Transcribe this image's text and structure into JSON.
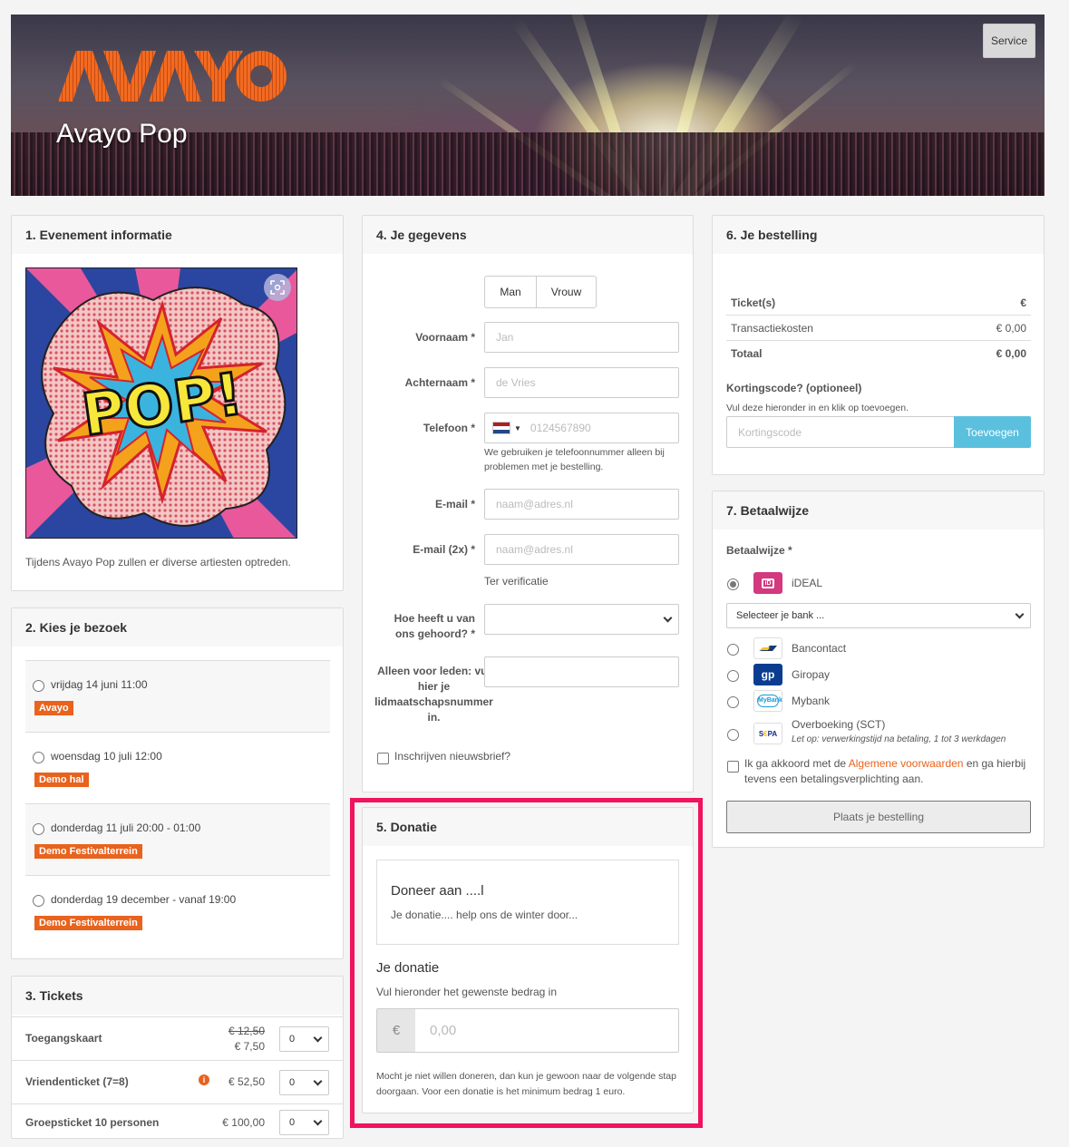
{
  "banner": {
    "logo_text": "AVAYO",
    "title": "Avayo Pop",
    "service_label": "Service"
  },
  "section1": {
    "title": "1. Evenement informatie",
    "image_text": "POP!",
    "description": "Tijdens Avayo Pop zullen er diverse artiesten optreden."
  },
  "section2": {
    "title": "2. Kies je bezoek",
    "visits": [
      {
        "date": "vrijdag 14 juni 11:00",
        "location": "Avayo"
      },
      {
        "date": "woensdag 10 juli 12:00",
        "location": "Demo hal"
      },
      {
        "date": "donderdag 11 juli 20:00 - 01:00",
        "location": "Demo Festivalterrein"
      },
      {
        "date": "donderdag 19 december - vanaf 19:00",
        "location": "Demo Festivalterrein"
      }
    ]
  },
  "section3": {
    "title": "3. Tickets",
    "tickets": [
      {
        "name": "Toegangskaart",
        "old_price": "€ 12,50",
        "price": "€ 7,50",
        "qty": "0"
      },
      {
        "name": "Vriendenticket (7=8)",
        "price": "€ 52,50",
        "qty": "0"
      },
      {
        "name": "Groepsticket 10 personen",
        "price": "€ 100,00",
        "qty": "0"
      }
    ]
  },
  "section4": {
    "title": "4. Je gegevens",
    "gender_options": [
      "Man",
      "Vrouw"
    ],
    "firstname_label": "Voornaam *",
    "firstname_placeholder": "Jan",
    "lastname_label": "Achternaam *",
    "lastname_placeholder": "de Vries",
    "phone_label": "Telefoon *",
    "phone_placeholder": "0124567890",
    "phone_note": "We gebruiken je telefoonnummer alleen bij problemen met je bestelling.",
    "email_label": "E-mail *",
    "email_placeholder": "naam@adres.nl",
    "email2_label": "E-mail (2x) *",
    "email2_placeholder": "naam@adres.nl",
    "email2_note": "Ter verificatie",
    "heard_label": "Hoe heeft u van ons gehoord? *",
    "heard_value": "",
    "member_label": "Alleen voor leden: vul hier je lidmaatschapsnummer in.",
    "member_value": "",
    "newsletter_label": "Inschrijven nieuwsbrief?"
  },
  "section5": {
    "title": "5. Donatie",
    "box_title": "Doneer aan ....l",
    "box_text": "Je donatie.... help ons de winter door...",
    "your_donation": "Je donatie",
    "instruction": "Vul hieronder het gewenste bedrag in",
    "currency": "€",
    "amount_placeholder": "0,00",
    "footnote": "Mocht je niet willen doneren, dan kun je gewoon naar de volgende stap doorgaan. Voor een donatie is het minimum bedrag 1 euro.",
    "highlight_color": "#f0135f"
  },
  "section6": {
    "title": "6. Je bestelling",
    "rows": [
      {
        "label": "Ticket(s)",
        "value": "€"
      },
      {
        "label": "Transactiekosten",
        "value": "€ 0,00"
      },
      {
        "label": "Totaal",
        "value": "€ 0,00"
      }
    ],
    "discount_title": "Kortingscode? (optioneel)",
    "discount_hint": "Vul deze hieronder in en klik op toevoegen.",
    "discount_placeholder": "Kortingscode",
    "add_button": "Toevoegen"
  },
  "section7": {
    "title": "7. Betaalwijze",
    "method_label": "Betaalwijze *",
    "bank_select": "Selecteer je bank ...",
    "methods": [
      {
        "name": "iDEAL",
        "icon": "ideal-icon",
        "selected": true
      },
      {
        "name": "Bancontact",
        "icon": "bancontact-icon"
      },
      {
        "name": "Giropay",
        "icon": "giropay-icon"
      },
      {
        "name": "Mybank",
        "icon": "mybank-icon"
      },
      {
        "name": "Overboeking (SCT)",
        "icon": "sepa-icon",
        "note": "Let op: verwerkingstijd na betaling, 1 tot 3 werkdagen"
      }
    ],
    "terms_prefix": "Ik ga akkoord met de",
    "terms_link": "Algemene voorwaarden",
    "terms_suffix": "en ga hierbij tevens een betalingsverplichting aan.",
    "order_button": "Plaats je bestelling"
  }
}
